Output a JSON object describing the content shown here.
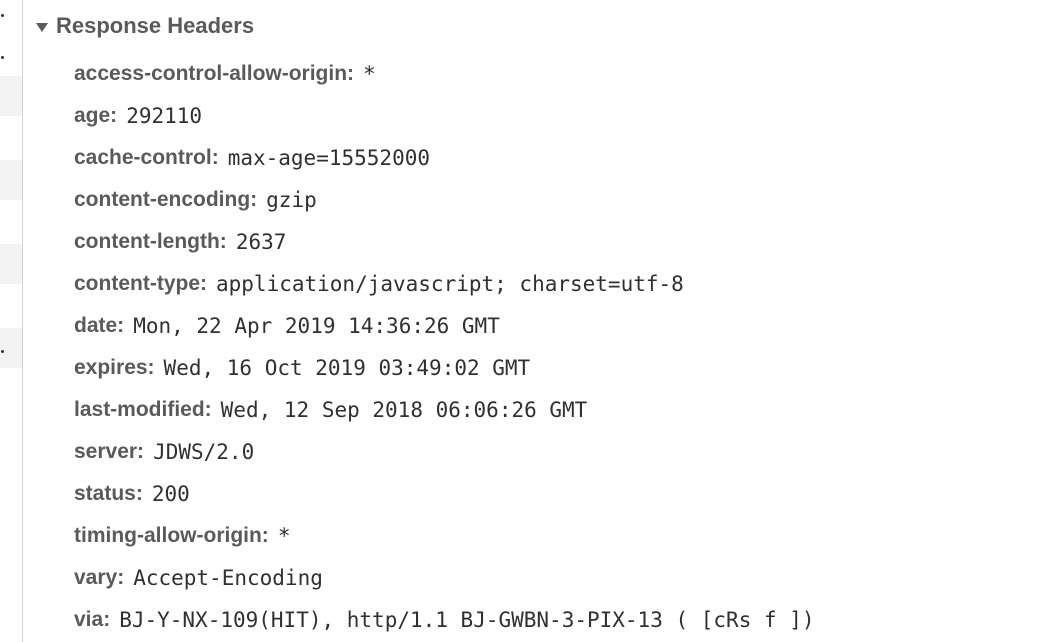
{
  "section": {
    "title": "Response Headers",
    "toggle_icon": "triangle-down-icon"
  },
  "headers": [
    {
      "name": "access-control-allow-origin:",
      "value": "*"
    },
    {
      "name": "age:",
      "value": "292110"
    },
    {
      "name": "cache-control:",
      "value": "max-age=15552000"
    },
    {
      "name": "content-encoding:",
      "value": "gzip"
    },
    {
      "name": "content-length:",
      "value": "2637"
    },
    {
      "name": "content-type:",
      "value": "application/javascript; charset=utf-8"
    },
    {
      "name": "date:",
      "value": "Mon, 22 Apr 2019 14:36:26 GMT"
    },
    {
      "name": "expires:",
      "value": "Wed, 16 Oct 2019 03:49:02 GMT"
    },
    {
      "name": "last-modified:",
      "value": "Wed, 12 Sep 2018 06:06:26 GMT"
    },
    {
      "name": "server:",
      "value": "JDWS/2.0"
    },
    {
      "name": "status:",
      "value": "200"
    },
    {
      "name": "timing-allow-origin:",
      "value": "*"
    },
    {
      "name": "vary:",
      "value": "Accept-Encoding"
    },
    {
      "name": "via:",
      "value": "BJ-Y-NX-109(HIT), http/1.1 BJ-GWBN-3-PIX-13 ( [cRs f ])"
    }
  ]
}
